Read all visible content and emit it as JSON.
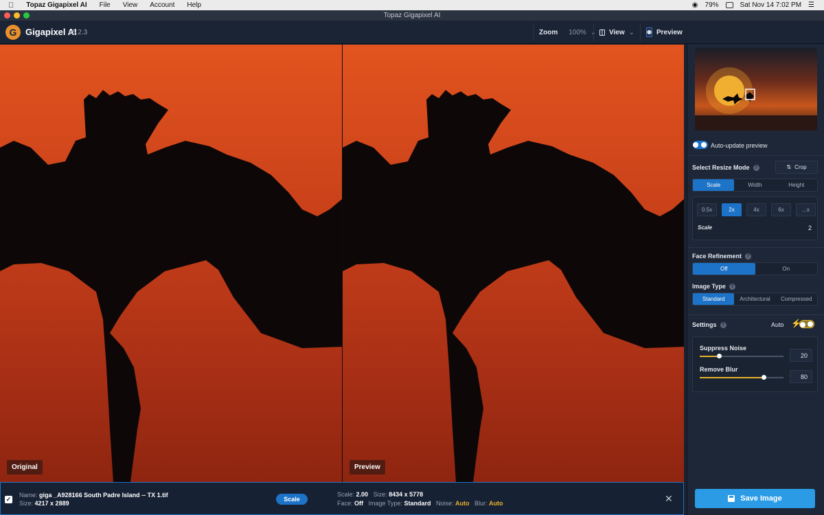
{
  "menubar": {
    "app_name": "Topaz Gigapixel AI",
    "menus": [
      "File",
      "View",
      "Account",
      "Help"
    ],
    "battery": "79%",
    "datetime": "Sat Nov 14  7:02 PM"
  },
  "window": {
    "title": "Topaz Gigapixel AI"
  },
  "header": {
    "app_title": "Gigapixel AI",
    "version": "v5.2.3",
    "zoom_label": "Zoom",
    "zoom_value": "100%",
    "view_label": "View",
    "preview_label": "Preview"
  },
  "panes": {
    "original_label": "Original",
    "preview_label": "Preview"
  },
  "sidebar": {
    "auto_update_label": "Auto-update preview",
    "resize_mode_label": "Select Resize Mode",
    "crop_label": "Crop",
    "resize_tabs": [
      "Scale",
      "Width",
      "Height"
    ],
    "scale_options": [
      "0.5x",
      "2x",
      "4x",
      "6x",
      "...x"
    ],
    "scale_label": "Scale",
    "scale_value": "2",
    "face_label": "Face Refinement",
    "face_options": [
      "Off",
      "On"
    ],
    "image_type_label": "Image Type",
    "image_types": [
      "Standard",
      "Architectural",
      "Compressed"
    ],
    "settings_label": "Settings",
    "auto_label": "Auto",
    "suppress_noise_label": "Suppress Noise",
    "suppress_noise_value": "20",
    "suppress_noise_fraction": 0.23,
    "remove_blur_label": "Remove Blur",
    "remove_blur_value": "80",
    "remove_blur_fraction": 0.77
  },
  "footer": {
    "name_label": "Name:",
    "name_value": "giga _A928166 South Padre Island -- TX 1.tif",
    "size_label": "Size:",
    "size_value": "4217 x 2889",
    "mode_pill": "Scale",
    "scale_label": "Scale:",
    "scale_value": "2.00",
    "out_size_label": "Size:",
    "out_size_value": "8434 x 5778",
    "face_label": "Face:",
    "face_value": "Off",
    "type_label": "Image Type:",
    "type_value": "Standard",
    "noise_label": "Noise:",
    "noise_value": "Auto",
    "blur_label": "Blur:",
    "blur_value": "Auto"
  },
  "save_label": "Save Image",
  "colors": {
    "accent": "#1c73c7",
    "save": "#2b9be6",
    "auto_yellow": "#e8b22a"
  }
}
